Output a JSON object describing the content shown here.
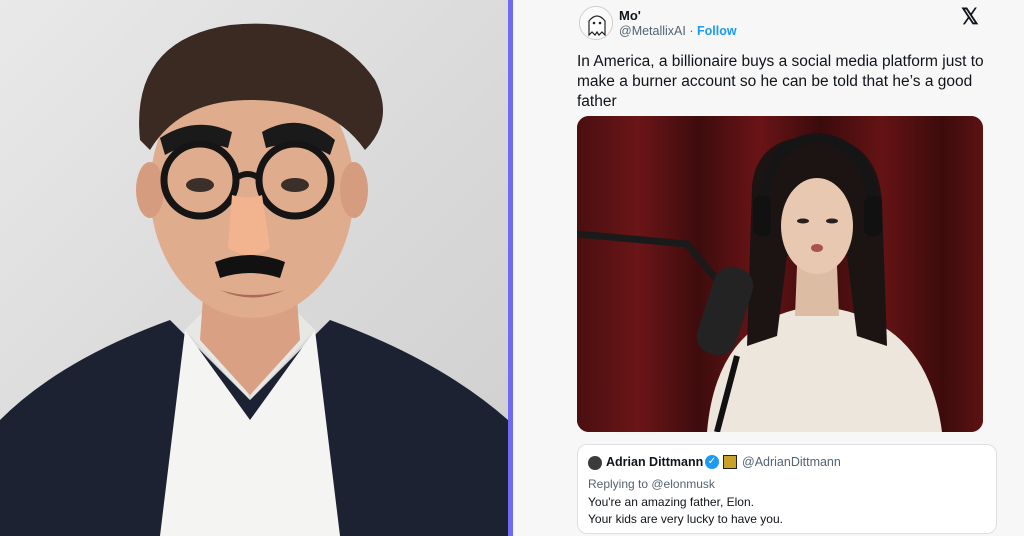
{
  "tweet": {
    "display_name": "Mo'",
    "handle": "@MetallixAI",
    "separator": " · ",
    "follow_label": "Follow",
    "text": "In America, a billionaire buys a social media platform just to make a burner account so he can be told that he’s a good father",
    "x_logo_glyph": "𝕏"
  },
  "quoted": {
    "name": "Adrian Dittmann",
    "handle": "@AdrianDittmann",
    "replying_prefix": "Replying to ",
    "replying_to": "@elonmusk",
    "line1": "You're an amazing father, Elon.",
    "line2": "Your kids are very lucky to have you."
  },
  "colors": {
    "divider": "#6f6af0",
    "link": "#1d9bf0",
    "text": "#0f1419",
    "muted": "#536471"
  },
  "icons": {
    "x_logo": "x-logo-icon",
    "verified": "verified-check-icon"
  }
}
